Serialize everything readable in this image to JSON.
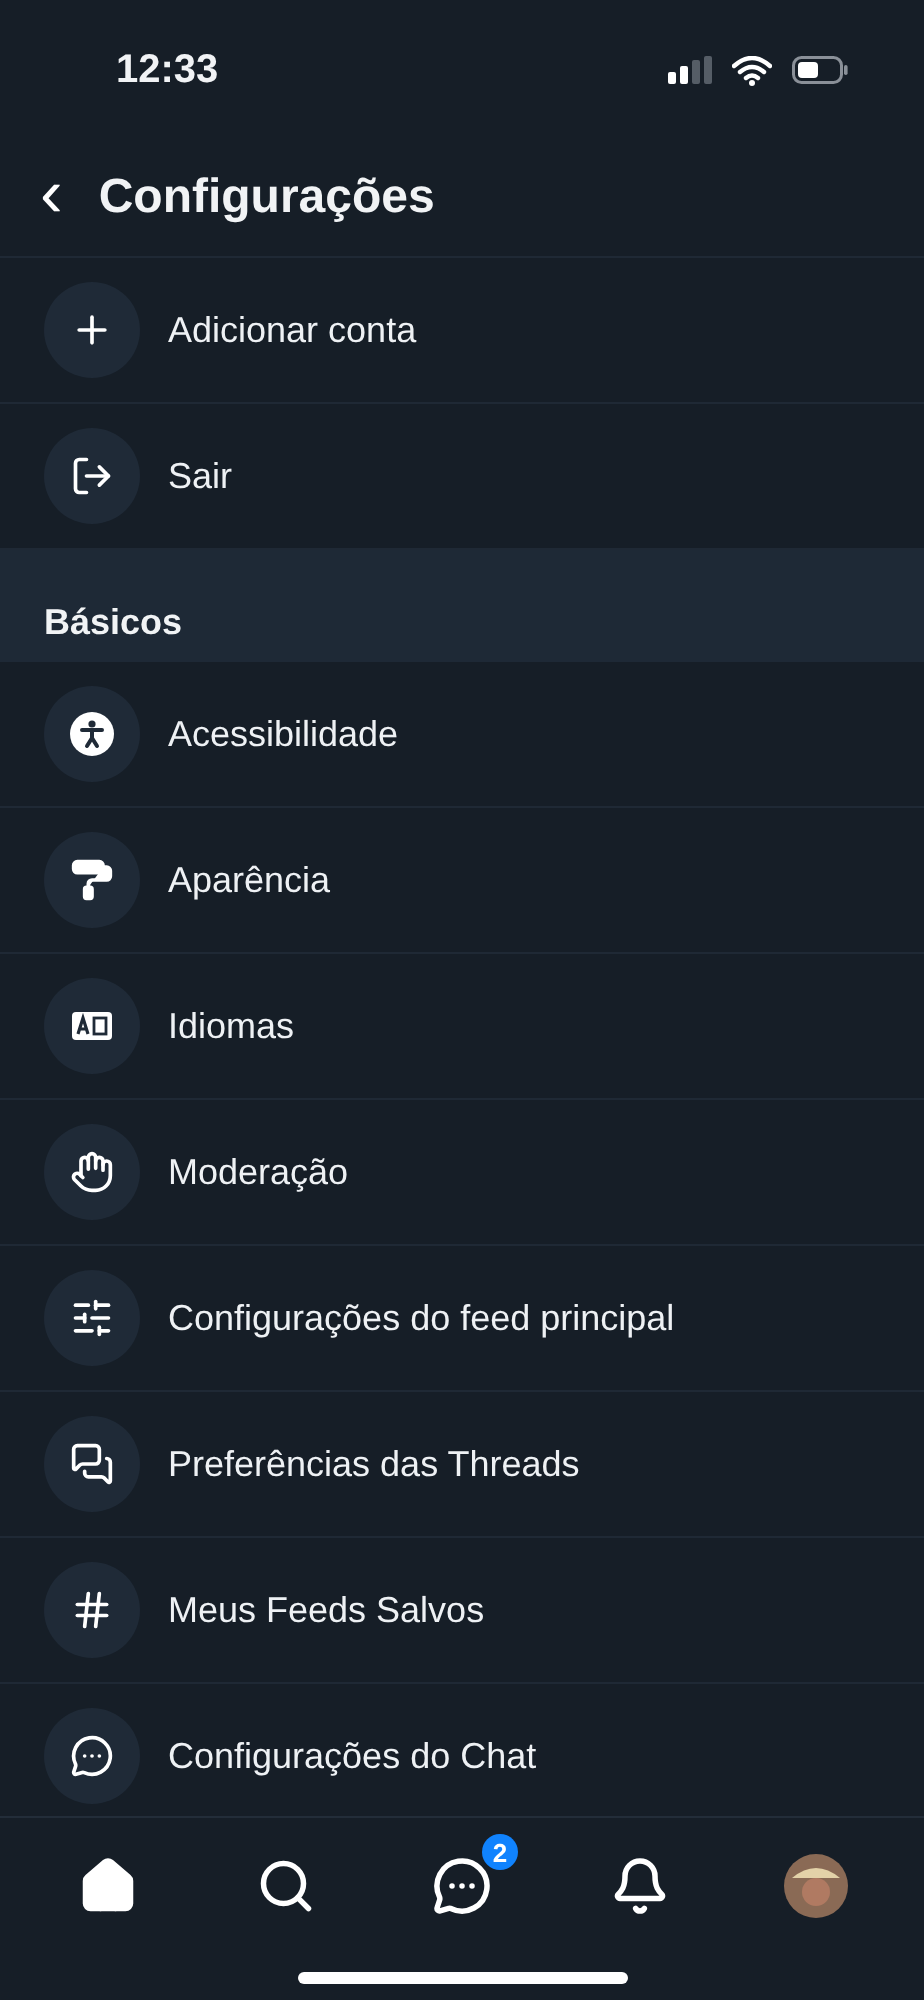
{
  "status_bar": {
    "time": "12:33"
  },
  "header": {
    "back": "‹",
    "title": "Configurações"
  },
  "account_items": [
    {
      "label": "Adicionar conta"
    },
    {
      "label": "Sair"
    }
  ],
  "section": {
    "title": "Básicos"
  },
  "basic_items": [
    {
      "label": "Acessibilidade"
    },
    {
      "label": "Aparência"
    },
    {
      "label": "Idiomas"
    },
    {
      "label": "Moderação"
    },
    {
      "label": "Configurações do feed principal"
    },
    {
      "label": "Preferências das Threads"
    },
    {
      "label": "Meus Feeds Salvos"
    },
    {
      "label": "Configurações do Chat"
    }
  ],
  "bottom_nav": [
    {
      "kind": "home",
      "selected": true
    },
    {
      "kind": "search",
      "selected": false
    },
    {
      "kind": "chat",
      "selected": false,
      "badge": "2"
    },
    {
      "kind": "bell",
      "selected": false
    },
    {
      "kind": "avatar",
      "selected": false
    }
  ]
}
